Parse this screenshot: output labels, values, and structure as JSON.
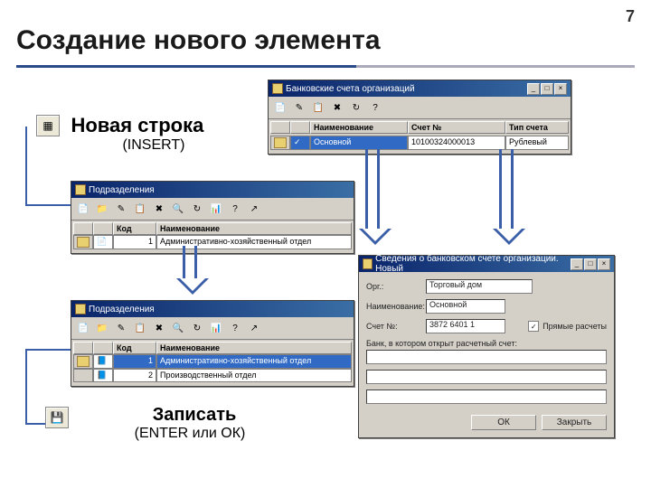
{
  "page_number": "7",
  "heading": "Создание нового элемента",
  "insert_label": {
    "main": "Новая строка",
    "sub": "(INSERT)"
  },
  "save_label": {
    "main": "Записать",
    "sub": "(ENTER или ОК)"
  },
  "win_accounts": {
    "title": "Банковские счета организаций",
    "columns": [
      "",
      "",
      "Наименование",
      "Счет №",
      "Тип счета"
    ],
    "row": {
      "name": "Основной",
      "number": "10100324000013",
      "type": "Рублевый"
    }
  },
  "win_dept1": {
    "title": "Подразделения",
    "columns": [
      "",
      "",
      "Код",
      "Наименование"
    ],
    "rows": [
      {
        "code": "1",
        "name": "Административно-хозяйственный отдел"
      }
    ]
  },
  "win_dept2": {
    "title": "Подразделения",
    "columns": [
      "",
      "",
      "Код",
      "Наименование"
    ],
    "rows": [
      {
        "code": "1",
        "name": "Административно-хозяйственный отдел"
      },
      {
        "code": "2",
        "name": "Производственный отдел"
      }
    ]
  },
  "dialog": {
    "title": "Сведения о банковском счете организации. Новый",
    "fields": {
      "org_label": "Орг.:",
      "org_value": "Торговый дом",
      "name_label": "Наименование:",
      "name_value": "Основной",
      "account_label": "Счет №:",
      "account_value": "3872 6401 1",
      "bank_label": "Банк, в котором открыт расчетный счет:",
      "bank_value": "",
      "currency_checkbox": "Прямые расчеты"
    },
    "buttons": {
      "ok": "ОК",
      "cancel": "Закрыть"
    }
  }
}
